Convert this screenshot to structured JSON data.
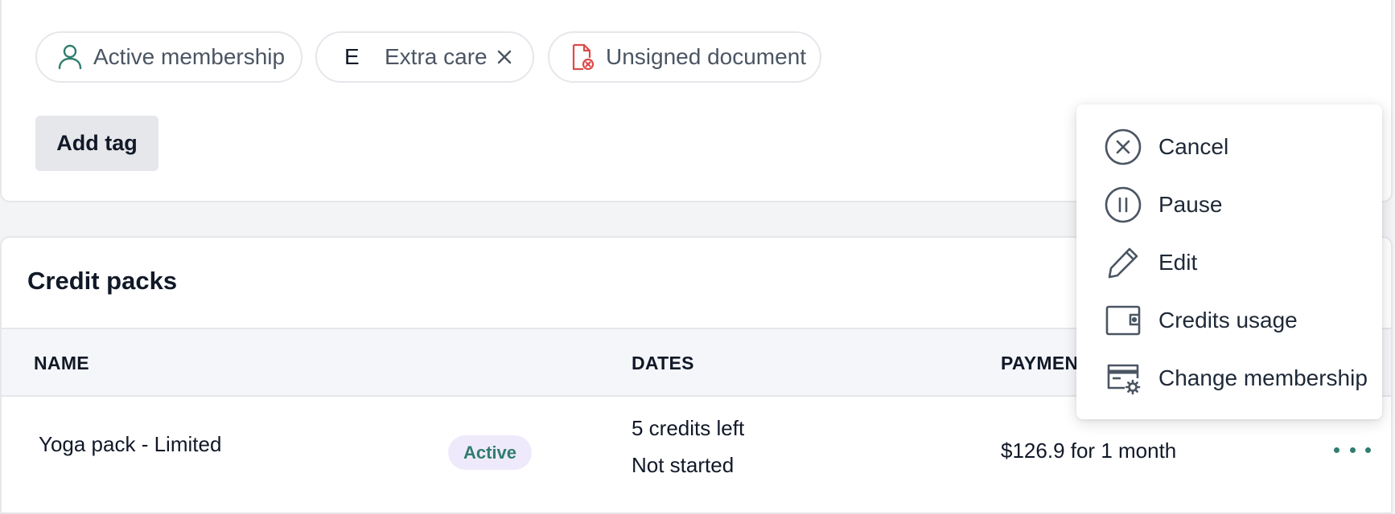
{
  "tags": {
    "items": [
      {
        "label": "Active membership",
        "icon": "user-icon"
      },
      {
        "letter": "E",
        "label": "Extra care",
        "icon": "close-icon"
      },
      {
        "label": "Unsigned document",
        "icon": "document-error-icon"
      }
    ],
    "add_tag_label": "Add tag"
  },
  "credit_packs": {
    "title": "Credit packs",
    "columns": {
      "name": "NAME",
      "dates": "DATES",
      "payment": "PAYMEN"
    },
    "rows": [
      {
        "name": "Yoga pack - Limited",
        "status": "Active",
        "credits": "5 credits left",
        "start": "Not started",
        "payment": "$126.9 for 1 month"
      }
    ]
  },
  "menu": {
    "items": [
      {
        "label": "Cancel",
        "icon": "cancel-circle-icon"
      },
      {
        "label": "Pause",
        "icon": "pause-circle-icon"
      },
      {
        "label": "Edit",
        "icon": "pencil-icon"
      },
      {
        "label": "Credits usage",
        "icon": "wallet-icon"
      },
      {
        "label": "Change membership",
        "icon": "card-settings-icon"
      }
    ]
  },
  "colors": {
    "accent_teal": "#2f7d6e",
    "danger_red": "#dc4a4a",
    "icon_slate": "#4b5563",
    "badge_bg": "#efeafb"
  }
}
